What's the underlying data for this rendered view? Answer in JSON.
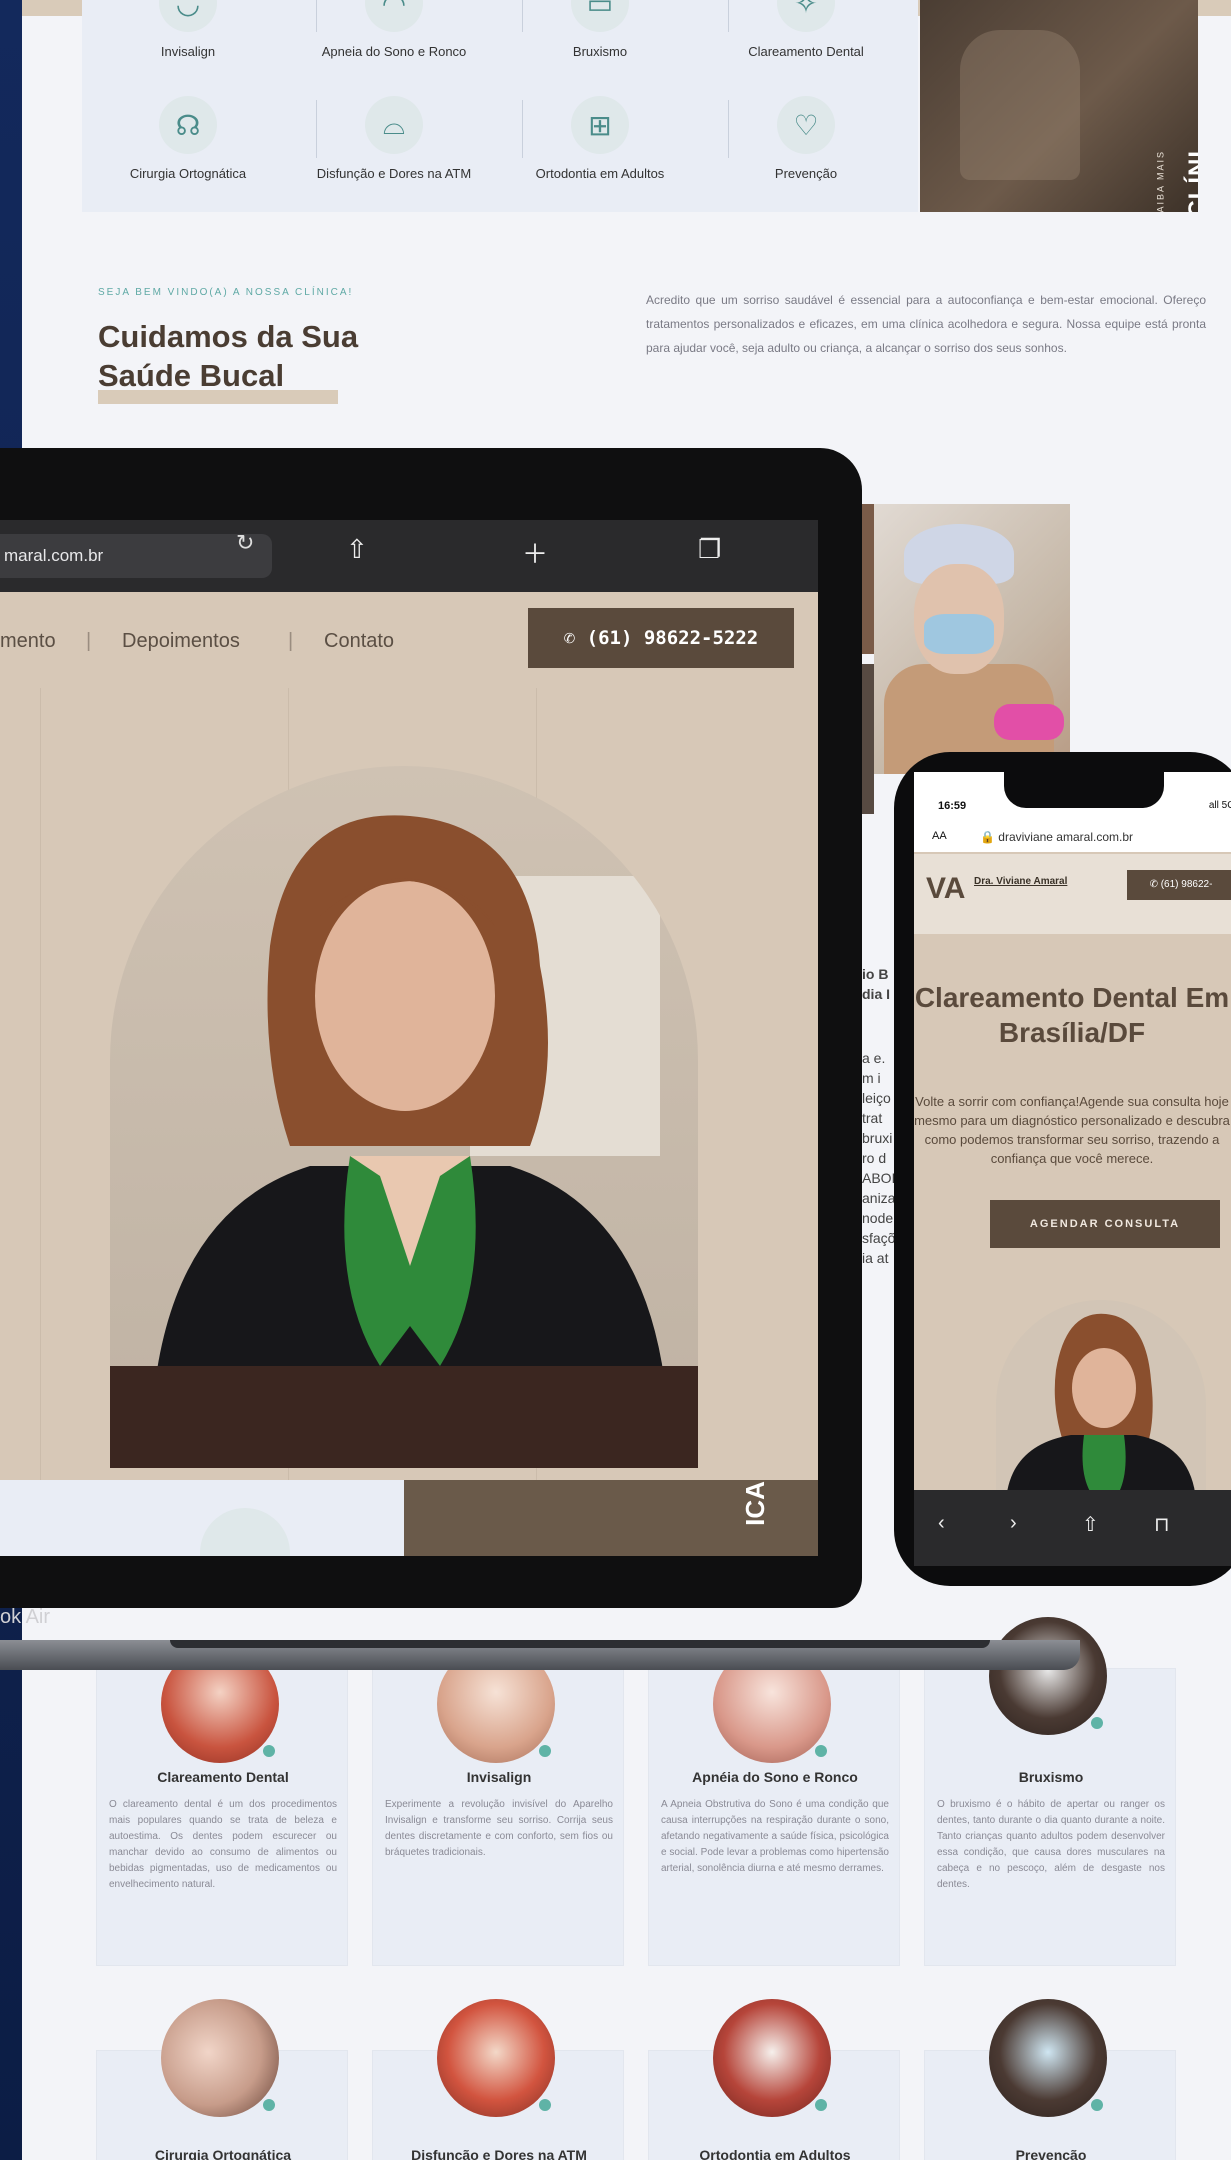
{
  "services_grid": {
    "row1": [
      "Invisalign",
      "Apneia do Sono e Ronco",
      "Bruxismo",
      "Clareamento Dental"
    ],
    "row2": [
      "Cirurgia Ortognática",
      "Disfunção e Dores na ATM",
      "Ortodontia em Adultos",
      "Prevenção"
    ],
    "about_title": "SOBRE A CLÍNI",
    "about_sub": "SAIBA MAIS"
  },
  "welcome": {
    "kicker": "SEJA BEM VINDO(A) A NOSSA CLÍNICA!",
    "title": "Cuidamos da Sua Saúde Bucal",
    "text": "Acredito que um sorriso saudável é essencial para a autoconfiança e bem-estar emocional. Ofereço tratamentos personalizados e eficazes, em uma clínica acolhedora e segura. Nossa equipe está pronta para ajudar você, seja adulto ou criança, a alcançar o sorriso dos seus sonhos."
  },
  "laptop": {
    "url": "maral.com.br",
    "nav": [
      "mento",
      "Depoimentos",
      "Contato"
    ],
    "phone": "✆ (61) 98622-5222",
    "bottom_text": "ICA",
    "label": "ok Air"
  },
  "background_text": [
    "io B",
    "dia I",
    "a e.",
    "m i",
    "leiço",
    "trat",
    "bruxi",
    "ro d",
    "ABOR",
    "aniza",
    "node",
    "sfaçõ",
    "ia at"
  ],
  "phone": {
    "time": "16:59",
    "signal": "all 5G",
    "aa": "AA",
    "url": "🔒 draviviane amaral.com.br",
    "logo": "VA",
    "logo_name": "Dra. Viviane Amaral",
    "call": "✆ (61) 98622-",
    "headline": "Clareamento Dental Em Brasília/DF",
    "paragraph": "Volte a sorrir com confiança!Agende sua consulta hoje mesmo para um diagnóstico personalizado e descubra como podemos transformar seu sorriso, trazendo a confiança que você merece.",
    "cta": "AGENDAR CONSULTA"
  },
  "cards_row1": [
    {
      "title": "Clareamento Dental",
      "text": "O clareamento dental é um dos procedimentos mais populares quando se trata de beleza e autoestima. Os dentes podem escurecer ou manchar devido ao consumo de alimentos ou bebidas pigmentadas, uso de medicamentos ou envelhecimento natural."
    },
    {
      "title": "Invisalign",
      "text": "Experimente a revolução invisível do Aparelho Invisalign e transforme seu sorriso. Corrija seus dentes discretamente e com conforto, sem fios ou bráquetes tradicionais."
    },
    {
      "title": "Apnéia do Sono e Ronco",
      "text": "A Apneia Obstrutiva do Sono é uma condição que causa interrupções na respiração durante o sono, afetando negativamente a saúde física, psicológica e social. Pode levar a problemas como hipertensão arterial, sonolência diurna e até mesmo derrames."
    },
    {
      "title": "Bruxismo",
      "text": "O bruxismo é o hábito de apertar ou ranger os dentes, tanto durante o dia quanto durante a noite. Tanto crianças quanto adultos podem desenvolver essa condição, que causa dores musculares na cabeça e no pescoço, além de desgaste nos dentes."
    }
  ],
  "cards_row2": [
    "Cirurgia Ortognática",
    "Disfunção e Dores na ATM",
    "Ortodontia em Adultos",
    "Prevenção"
  ],
  "colors": {
    "brand_brown": "#5a4a3c",
    "beige": "#d7c8b7",
    "teal": "#5fa9a5",
    "navy": "#0f2350"
  }
}
